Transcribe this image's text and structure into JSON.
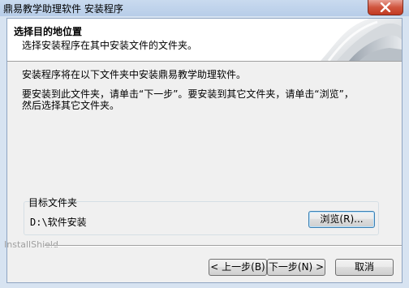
{
  "window": {
    "title": "鼎易教学助理软件 安装程序"
  },
  "header": {
    "title": "选择目的地位置",
    "subtitle": "选择安装程序在其中安装文件的文件夹。"
  },
  "body": {
    "line1": "安装程序将在以下文件夹中安装鼎易教学助理软件。",
    "line2": "要安装到此文件夹，请单击“下一步”。要安装到其它文件夹，请单击“浏览”，",
    "line3": "然后选择其它文件夹。"
  },
  "destination": {
    "group_label": "目标文件夹",
    "path": "D:\\软件安装",
    "browse_label": "浏览(R)..."
  },
  "footer": {
    "brand": "InstallShield",
    "back_label": "< 上一步(B)",
    "next_label": "下一步(N) >",
    "cancel_label": "取消"
  },
  "icons": {
    "close": "close-icon",
    "banner_art": "installshield-banner-art"
  },
  "colors": {
    "titlebar": "#c9daef",
    "close_button": "#c7442c",
    "dialog_bg": "#f0f0f0",
    "banner_bg": "#ffffff",
    "focus_border": "#3c7fb1"
  }
}
